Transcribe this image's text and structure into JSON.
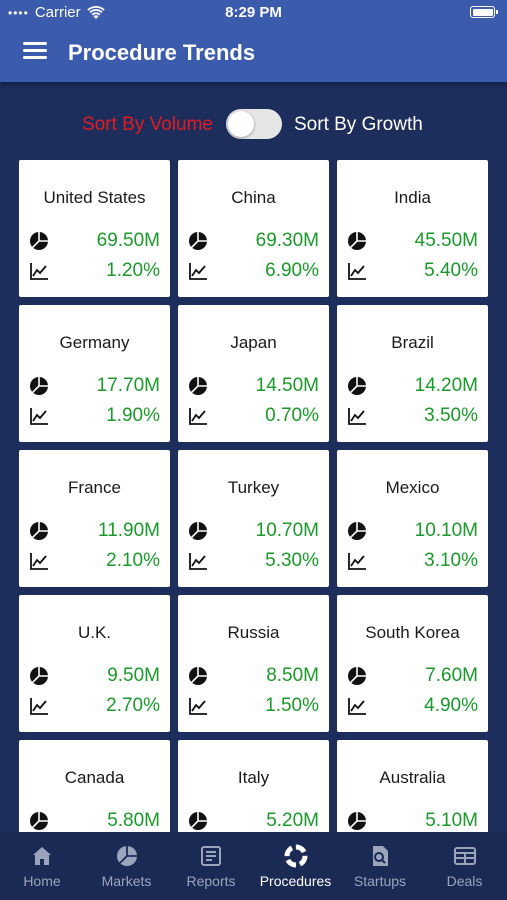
{
  "status": {
    "carrier": "Carrier",
    "time": "8:29 PM"
  },
  "header": {
    "title": "Procedure Trends"
  },
  "sort": {
    "volume_label": "Sort By Volume",
    "growth_label": "Sort By Growth"
  },
  "colors": {
    "value_green": "#1a9a2a",
    "active_sort_red": "#e11b22",
    "header_blue": "#3b5bad",
    "background_navy": "#1d2d5c"
  },
  "cards": [
    {
      "country": "United States",
      "volume": "69.50M",
      "growth": "1.20%"
    },
    {
      "country": "China",
      "volume": "69.30M",
      "growth": "6.90%"
    },
    {
      "country": "India",
      "volume": "45.50M",
      "growth": "5.40%"
    },
    {
      "country": "Germany",
      "volume": "17.70M",
      "growth": "1.90%"
    },
    {
      "country": "Japan",
      "volume": "14.50M",
      "growth": "0.70%"
    },
    {
      "country": "Brazil",
      "volume": "14.20M",
      "growth": "3.50%"
    },
    {
      "country": "France",
      "volume": "11.90M",
      "growth": "2.10%"
    },
    {
      "country": "Turkey",
      "volume": "10.70M",
      "growth": "5.30%"
    },
    {
      "country": "Mexico",
      "volume": "10.10M",
      "growth": "3.10%"
    },
    {
      "country": "U.K.",
      "volume": "9.50M",
      "growth": "2.70%"
    },
    {
      "country": "Russia",
      "volume": "8.50M",
      "growth": "1.50%"
    },
    {
      "country": "South Korea",
      "volume": "7.60M",
      "growth": "4.90%"
    },
    {
      "country": "Canada",
      "volume": "5.80M",
      "growth": ""
    },
    {
      "country": "Italy",
      "volume": "5.20M",
      "growth": ""
    },
    {
      "country": "Australia",
      "volume": "5.10M",
      "growth": ""
    }
  ],
  "tabs": [
    {
      "label": "Home",
      "icon": "home-icon"
    },
    {
      "label": "Markets",
      "icon": "pie-chart-icon"
    },
    {
      "label": "Reports",
      "icon": "report-icon"
    },
    {
      "label": "Procedures",
      "icon": "procedures-icon",
      "active": true
    },
    {
      "label": "Startups",
      "icon": "startups-icon"
    },
    {
      "label": "Deals",
      "icon": "deals-icon"
    }
  ]
}
